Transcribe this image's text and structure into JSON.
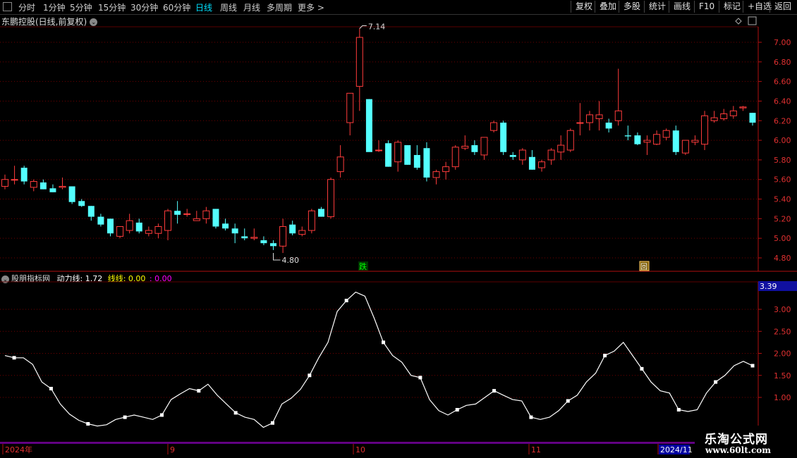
{
  "toolbar": {
    "timeframes": [
      "分时",
      "1分钟",
      "5分钟",
      "15分钟",
      "30分钟",
      "60分钟",
      "日线",
      "周线",
      "月线",
      "多周期",
      "更多 >"
    ],
    "active": "日线",
    "right_buttons": [
      "复权",
      "叠加",
      "多股",
      "统计",
      "画线",
      "F10",
      "标记",
      "+自选",
      "返回"
    ]
  },
  "stock_title": "东鹏控股(日线,前复权)",
  "indicator": {
    "name": "股朋指标网",
    "line1": "动力线: 1.72",
    "line2": "线线: 0.00",
    "line3": ": 0.00",
    "current_value": "3.39"
  },
  "markers": {
    "high_label": "7.14",
    "low_label": "4.80",
    "die_label": "跌",
    "hui_label": "回"
  },
  "price_axis": [
    "7.00",
    "6.80",
    "6.60",
    "6.40",
    "6.20",
    "6.00",
    "5.80",
    "5.60",
    "5.40",
    "5.20",
    "5.00",
    "4.80"
  ],
  "indicator_axis": [
    "3.00",
    "2.50",
    "2.00",
    "1.50",
    "1.00"
  ],
  "date_labels": [
    "2024年",
    "9",
    "10",
    "11",
    "2024/11"
  ],
  "logo": {
    "cn": "乐淘公式网",
    "url": "www.60lt.com"
  },
  "chart_data": [
    {
      "type": "candlestick",
      "title": "东鹏控股(日线,前复权)",
      "ylim": [
        4.7,
        7.25
      ],
      "ohlc": [
        [
          5.53,
          5.65,
          5.5,
          5.6
        ],
        [
          5.6,
          5.74,
          5.55,
          5.6
        ],
        [
          5.72,
          5.74,
          5.55,
          5.58
        ],
        [
          5.52,
          5.6,
          5.48,
          5.58
        ],
        [
          5.57,
          5.6,
          5.5,
          5.5
        ],
        [
          5.51,
          5.55,
          5.47,
          5.47
        ],
        [
          5.52,
          5.62,
          5.5,
          5.53
        ],
        [
          5.53,
          5.53,
          5.35,
          5.37
        ],
        [
          5.38,
          5.4,
          5.32,
          5.33
        ],
        [
          5.33,
          5.33,
          5.18,
          5.22
        ],
        [
          5.22,
          5.25,
          5.12,
          5.14
        ],
        [
          5.2,
          5.2,
          5.02,
          5.05
        ],
        [
          5.02,
          5.12,
          5.0,
          5.12
        ],
        [
          5.08,
          5.25,
          5.05,
          5.18
        ],
        [
          5.16,
          5.2,
          5.05,
          5.07
        ],
        [
          5.05,
          5.12,
          5.02,
          5.08
        ],
        [
          5.05,
          5.15,
          5.0,
          5.12
        ],
        [
          5.08,
          5.3,
          4.98,
          5.28
        ],
        [
          5.28,
          5.38,
          5.15,
          5.24
        ],
        [
          5.25,
          5.3,
          5.22,
          5.25
        ],
        [
          5.18,
          5.28,
          5.18,
          5.2
        ],
        [
          5.2,
          5.32,
          5.15,
          5.28
        ],
        [
          5.3,
          5.3,
          5.1,
          5.12
        ],
        [
          5.15,
          5.2,
          5.08,
          5.1
        ],
        [
          5.1,
          5.15,
          4.95,
          5.05
        ],
        [
          5.02,
          5.1,
          4.98,
          5.0
        ],
        [
          5.0,
          5.1,
          4.98,
          5.01
        ],
        [
          4.98,
          5.02,
          4.93,
          4.95
        ],
        [
          4.95,
          4.98,
          4.88,
          4.92
        ],
        [
          4.92,
          5.2,
          4.85,
          5.12
        ],
        [
          5.14,
          5.18,
          5.03,
          5.05
        ],
        [
          5.04,
          5.12,
          5.02,
          5.08
        ],
        [
          5.08,
          5.3,
          5.05,
          5.28
        ],
        [
          5.3,
          5.32,
          5.22,
          5.22
        ],
        [
          5.22,
          5.62,
          5.2,
          5.6
        ],
        [
          5.68,
          5.95,
          5.62,
          5.83
        ],
        [
          6.18,
          6.48,
          6.05,
          6.48
        ],
        [
          6.55,
          7.14,
          6.3,
          7.05
        ],
        [
          6.42,
          6.42,
          5.9,
          5.88
        ],
        [
          5.9,
          6.0,
          5.88,
          5.9
        ],
        [
          5.97,
          6.0,
          5.73,
          5.73
        ],
        [
          5.78,
          6.0,
          5.68,
          5.98
        ],
        [
          5.95,
          5.95,
          5.75,
          5.75
        ],
        [
          5.85,
          5.95,
          5.7,
          5.72
        ],
        [
          5.92,
          5.98,
          5.58,
          5.62
        ],
        [
          5.62,
          5.7,
          5.55,
          5.68
        ],
        [
          5.68,
          5.78,
          5.6,
          5.73
        ],
        [
          5.73,
          5.95,
          5.7,
          5.93
        ],
        [
          5.92,
          6.05,
          5.9,
          5.94
        ],
        [
          5.95,
          6.0,
          5.85,
          5.88
        ],
        [
          5.85,
          6.0,
          5.8,
          6.03
        ],
        [
          6.1,
          6.2,
          6.08,
          6.18
        ],
        [
          6.18,
          6.2,
          5.85,
          5.88
        ],
        [
          5.85,
          5.88,
          5.8,
          5.83
        ],
        [
          5.8,
          5.92,
          5.75,
          5.9
        ],
        [
          5.83,
          5.9,
          5.7,
          5.7
        ],
        [
          5.72,
          5.8,
          5.68,
          5.78
        ],
        [
          5.8,
          5.92,
          5.75,
          5.9
        ],
        [
          5.88,
          6.05,
          5.8,
          5.95
        ],
        [
          5.9,
          6.12,
          5.88,
          6.1
        ],
        [
          6.18,
          6.38,
          6.05,
          6.18
        ],
        [
          6.18,
          6.3,
          6.1,
          6.26
        ],
        [
          6.22,
          6.4,
          6.1,
          6.26
        ],
        [
          6.18,
          6.22,
          6.08,
          6.12
        ],
        [
          6.2,
          6.73,
          6.15,
          6.3
        ],
        [
          6.05,
          6.15,
          6.0,
          6.04
        ],
        [
          6.05,
          6.08,
          5.95,
          5.96
        ],
        [
          5.98,
          6.05,
          5.85,
          6.0
        ],
        [
          5.96,
          6.1,
          5.95,
          6.06
        ],
        [
          6.03,
          6.12,
          6.0,
          6.1
        ],
        [
          6.1,
          6.15,
          5.85,
          5.88
        ],
        [
          5.87,
          6.0,
          5.85,
          6.0
        ],
        [
          5.98,
          6.05,
          5.95,
          6.0
        ],
        [
          5.96,
          6.3,
          5.9,
          6.25
        ],
        [
          6.2,
          6.3,
          6.18,
          6.23
        ],
        [
          6.22,
          6.32,
          6.2,
          6.27
        ],
        [
          6.25,
          6.35,
          6.22,
          6.3
        ],
        [
          6.33,
          6.35,
          6.3,
          6.34
        ],
        [
          6.28,
          6.28,
          6.15,
          6.18
        ]
      ]
    },
    {
      "type": "line",
      "title": "股朋指标网",
      "ylim": [
        0.4,
        3.5
      ],
      "values": [
        1.95,
        1.9,
        1.9,
        1.75,
        1.35,
        1.2,
        0.85,
        0.62,
        0.48,
        0.4,
        0.35,
        0.38,
        0.5,
        0.55,
        0.6,
        0.55,
        0.5,
        0.6,
        0.95,
        1.08,
        1.2,
        1.15,
        1.3,
        1.05,
        0.85,
        0.65,
        0.55,
        0.5,
        0.32,
        0.42,
        0.85,
        0.98,
        1.18,
        1.5,
        1.9,
        2.25,
        2.95,
        3.2,
        3.39,
        3.3,
        2.8,
        2.25,
        1.95,
        1.8,
        1.5,
        1.45,
        0.95,
        0.7,
        0.6,
        0.72,
        0.82,
        0.85,
        1.0,
        1.15,
        1.05,
        0.95,
        0.92,
        0.55,
        0.5,
        0.55,
        0.7,
        0.92,
        1.05,
        1.35,
        1.55,
        1.95,
        2.05,
        2.25,
        1.95,
        1.65,
        1.35,
        1.15,
        1.1,
        0.72,
        0.68,
        0.72,
        1.1,
        1.35,
        1.5,
        1.72,
        1.82,
        1.72
      ]
    }
  ]
}
